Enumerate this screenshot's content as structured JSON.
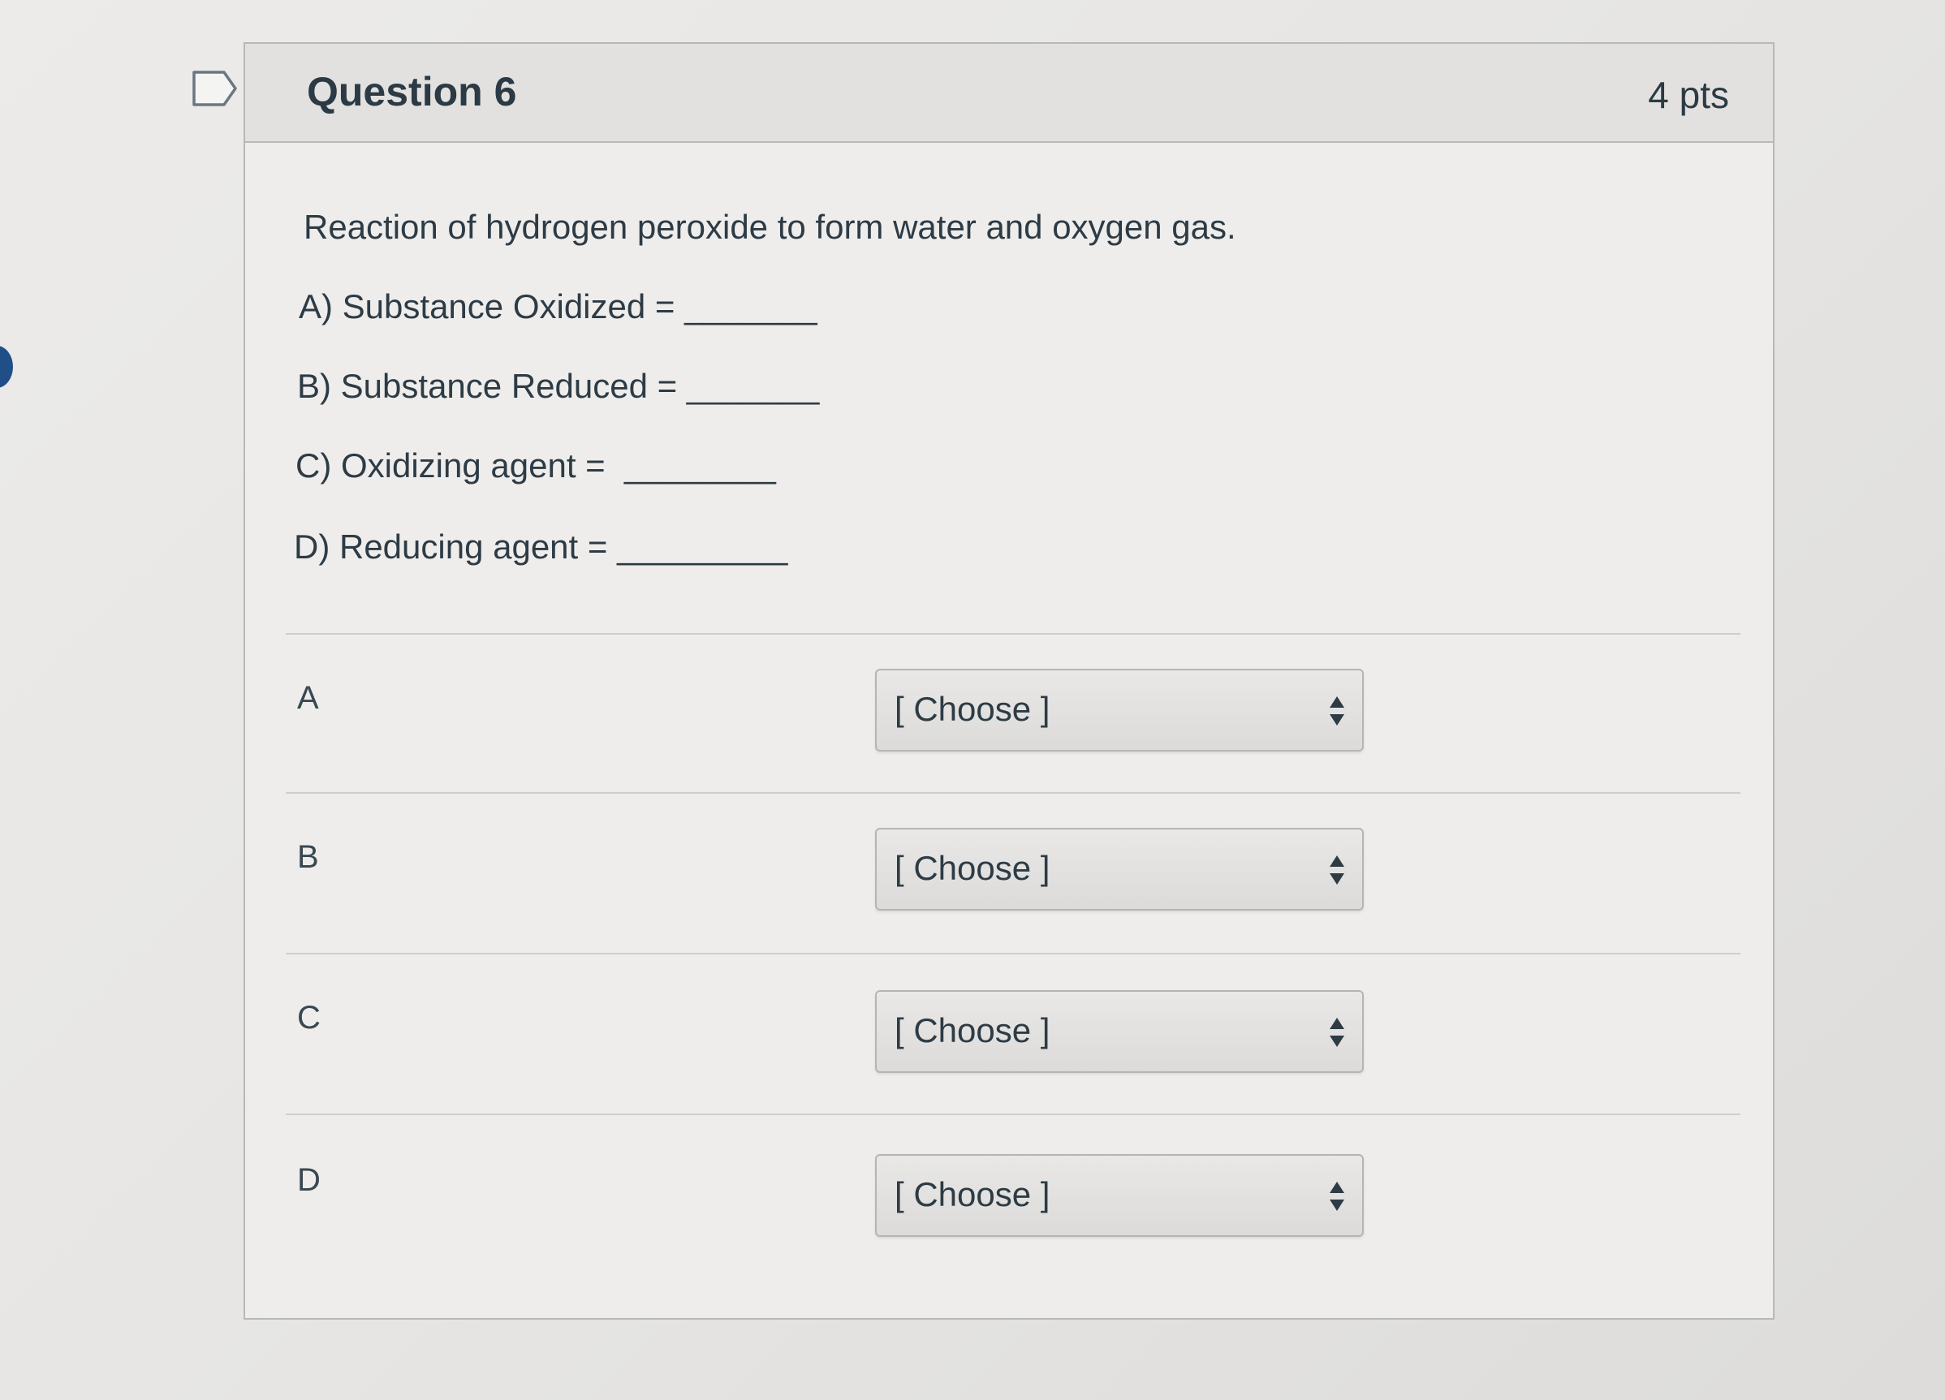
{
  "question": {
    "title": "Question 6",
    "points": "4 pts",
    "prompt": "Reaction of hydrogen peroxide to form water and oxygen gas.",
    "subquestions": [
      "A) Substance Oxidized = _______",
      "B) Substance Reduced = _______",
      "C) Oxidizing agent =  ________",
      "D) Reducing agent = _________"
    ]
  },
  "answers": [
    {
      "label": "A",
      "selected": "[ Choose ]"
    },
    {
      "label": "B",
      "selected": "[ Choose ]"
    },
    {
      "label": "C",
      "selected": "[ Choose ]"
    },
    {
      "label": "D",
      "selected": "[ Choose ]"
    }
  ],
  "icons": {
    "bookmark": "bookmark-flag-icon",
    "select_arrows": "up-down-arrows-icon"
  },
  "colors": {
    "text": "#2d3b45",
    "card_background": "#eeedeb",
    "header_background": "#e2e1df",
    "border": "#b8b8b6"
  }
}
